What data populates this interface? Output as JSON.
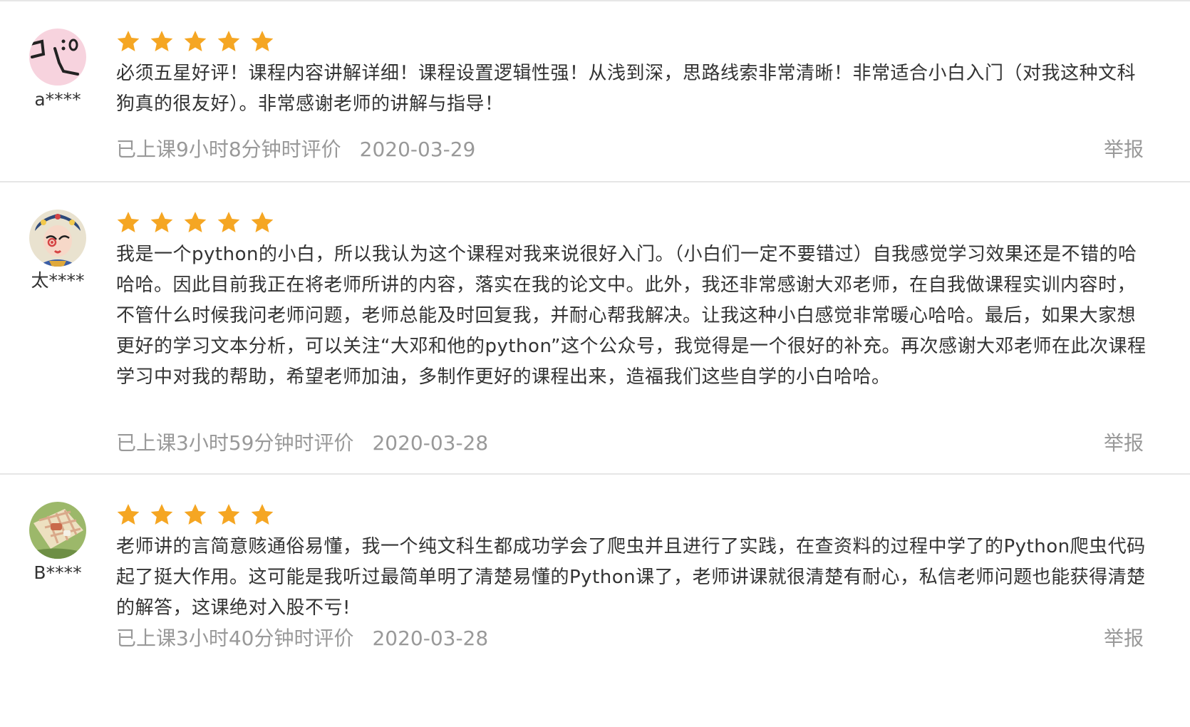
{
  "colors": {
    "star": "#F5A623",
    "text": "#333333",
    "meta": "#999999",
    "divider": "#E6E6E6"
  },
  "reviews": [
    {
      "username": "a****",
      "avatar": "pink-doodle-avatar",
      "rating": 5,
      "comment": "必须五星好评！课程内容讲解详细！课程设置逻辑性强！从浅到深，思路线索非常清晰！非常适合小白入门（对我这种文科狗真的很友好）。非常感谢老师的讲解与指导！",
      "study_time": "已上课9小时8分钟时评价",
      "date": "2020-03-29",
      "report": "举报"
    },
    {
      "username": "太****",
      "avatar": "opera-mask-avatar",
      "rating": 5,
      "comment": "我是一个python的小白，所以我认为这个课程对我来说很好入门。（小白们一定不要错过）自我感觉学习效果还是不错的哈哈哈。因此目前我正在将老师所讲的内容，落实在我的论文中。此外，我还非常感谢大邓老师，在自我做课程实训内容时，不管什么时候我问老师问题，老师总能及时回复我，并耐心帮我解决。让我这种小白感觉非常暖心哈哈。最后，如果大家想更好的学习文本分析，可以关注“大邓和他的python”这个公众号，我觉得是一个很好的补充。再次感谢大邓老师在此次课程学习中对我的帮助，希望老师加油，多制作更好的课程出来，造福我们这些自学的小白哈哈。",
      "study_time": "已上课3小时59分钟时评价",
      "date": "2020-03-28",
      "report": "举报"
    },
    {
      "username": "B****",
      "avatar": "picnic-photo-avatar",
      "rating": 5,
      "comment": "老师讲的言简意赅通俗易懂，我一个纯文科生都成功学会了爬虫并且进行了实践，在查资料的过程中学了的Python爬虫代码起了挺大作用。这可能是我听过最简单明了清楚易懂的Python课了，老师讲课就很清楚有耐心，私信老师问题也能获得清楚的解答，这课绝对入股不亏!",
      "study_time": "已上课3小时40分钟时评价",
      "date": "2020-03-28",
      "report": "举报"
    }
  ]
}
